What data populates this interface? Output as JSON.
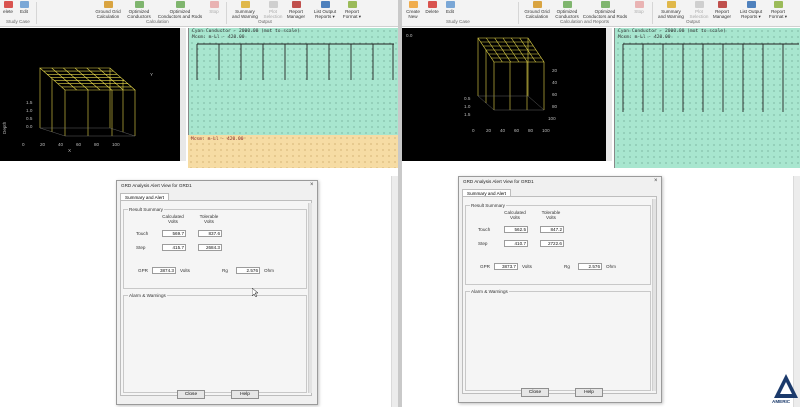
{
  "left": {
    "ribbon": {
      "buttons": [
        {
          "id": "delete",
          "label": "elete"
        },
        {
          "id": "edit",
          "label": "Edit"
        },
        {
          "id": "grid-calc",
          "label": "Ground Grid\nCalculation"
        },
        {
          "id": "opt-cond",
          "label": "Optimized\nConductors"
        },
        {
          "id": "opt-cond-rods",
          "label": "Optimized\nConductors and Rods"
        },
        {
          "id": "stop",
          "label": "Stop"
        },
        {
          "id": "summary",
          "label": "Summary\nand Warning"
        },
        {
          "id": "plot",
          "label": "Plot\nSelection"
        },
        {
          "id": "report-mgr",
          "label": "Report\nManager"
        },
        {
          "id": "list-output",
          "label": "List Output\nReports ▾"
        },
        {
          "id": "report-format",
          "label": "Report\nFormat ▾"
        }
      ],
      "groups": {
        "study_case": "Study Case",
        "calculation": "Calculation",
        "output": "Output"
      }
    },
    "view3d": {
      "axis_depth": "Depth",
      "axis_x": "X",
      "axis_y": "Y",
      "z_ticks": [
        "0.0",
        "0.5",
        "1.0",
        "1.5"
      ],
      "x_ticks": [
        "0",
        "20",
        "40",
        "60",
        "80",
        "100"
      ]
    },
    "plan": {
      "header1": "Cyan  Conductor - 2000.00  (mot to scale)",
      "header2": "Mcsm: m-Ll - 420.00",
      "header3": "Mcsm: m-Ll - 420.00"
    },
    "dialog": {
      "title": "GRD Analysis Alert View for GRD1",
      "tab": "Summary and Alert",
      "result_summary": "Result Summary",
      "col_calculated": "Calculated\nVolts",
      "col_tolerable": "Tolerable\nVolts",
      "touch_label": "Touch",
      "touch_calc": "569.7",
      "touch_tol": "837.6",
      "step_label": "Step",
      "step_calc": "415.7",
      "step_tol": "2684.3",
      "gpr_label": "GPR",
      "gpr_value": "3874.3",
      "gpr_unit": "Volts",
      "rg_label": "Rg",
      "rg_value": "2.576",
      "rg_unit": "Ohm",
      "alarm": "Alarm & Warnings",
      "close": "Close",
      "help": "Help"
    }
  },
  "right": {
    "ribbon": {
      "buttons": [
        {
          "id": "create-new",
          "label": "Create\nNew"
        },
        {
          "id": "delete",
          "label": "Delete"
        },
        {
          "id": "edit",
          "label": "Edit"
        },
        {
          "id": "grid-calc",
          "label": "Ground Grid\nCalculation"
        },
        {
          "id": "opt-cond",
          "label": "Optimized\nConductors"
        },
        {
          "id": "opt-cond-rods",
          "label": "Optimized\nConductors and Rods"
        },
        {
          "id": "stop",
          "label": "Stop"
        },
        {
          "id": "summary",
          "label": "Summary\nand Warning"
        },
        {
          "id": "plot",
          "label": "Plot\nSelection"
        },
        {
          "id": "report-mgr",
          "label": "Report\nManager"
        },
        {
          "id": "list-output",
          "label": "List Output\nReports ▾"
        },
        {
          "id": "report-format",
          "label": "Report\nFormat ▾"
        }
      ],
      "groups": {
        "study_case": "Study Case",
        "calculation": "Calculation and Reports",
        "output": "Output"
      }
    },
    "view3d": {
      "z_ticks": [
        "0.5",
        "1.0",
        "1.5"
      ],
      "y_ticks": [
        "20",
        "40",
        "60",
        "80",
        "100"
      ],
      "x_ticks": [
        "0",
        "20",
        "40",
        "60",
        "80",
        "100"
      ],
      "corner": "0.0"
    },
    "plan": {
      "header1": "Cyan  Conductor - 2000.00  (mot to scale)",
      "header2": "Mcsm: m-Ll - 420.00"
    },
    "dialog": {
      "title": "GRD Analysis Alert View for GRD1",
      "tab": "Summary and Alert",
      "result_summary": "Result Summary",
      "col_calculated": "Calculated\nVolts",
      "col_tolerable": "Tolerable\nVolts",
      "touch_label": "Touch",
      "touch_calc": "562.5",
      "touch_tol": "847.2",
      "step_label": "Step",
      "step_calc": "410.7",
      "step_tol": "2722.6",
      "gpr_label": "GPR",
      "gpr_value": "3873.7",
      "gpr_unit": "Volts",
      "rg_label": "Rg",
      "rg_value": "2.576",
      "rg_unit": "Ohm",
      "alarm": "Alarm & Warnings",
      "close": "Close",
      "help": "Help"
    }
  },
  "logo": {
    "text": "AMERIC"
  },
  "colors": {
    "ribbon_bg": "#f3f3f3",
    "plan_green": "#a8e6cf",
    "plan_orange": "#f6dca4",
    "grid_yellow": "#e6d84a",
    "dialog_bg": "#f0f0f0"
  }
}
